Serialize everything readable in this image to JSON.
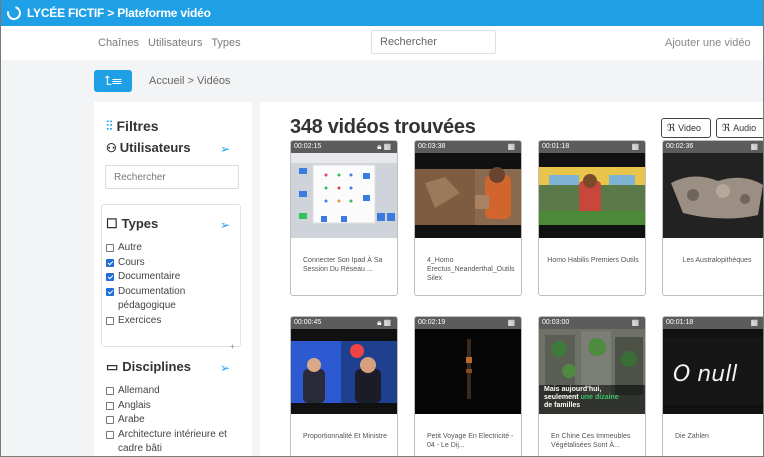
{
  "header": {
    "title": "LYCÉE FICTIF > Plateforme vidéo"
  },
  "nav": {
    "links": [
      "Chaînes",
      "Utilisateurs",
      "Types"
    ],
    "search_placeholder": "Rechercher",
    "add_video": "Ajouter une vidéo"
  },
  "breadcrumb": {
    "text": "Accueil > Vidéos",
    "menu_icon": "⮤☰"
  },
  "sidebar": {
    "filters_title": "Filtres",
    "users_title": "Utilisateurs",
    "search_placeholder": "Rechercher",
    "types": {
      "title": "Types",
      "items": [
        {
          "label": "Autre",
          "checked": false
        },
        {
          "label": "Cours",
          "checked": true
        },
        {
          "label": "Documentaire",
          "checked": true
        },
        {
          "label": "Documentation pédagogique",
          "checked": true
        },
        {
          "label": "Exercices",
          "checked": false
        }
      ]
    },
    "disciplines": {
      "title": "Disciplines",
      "items": [
        {
          "label": "Allemand",
          "checked": false
        },
        {
          "label": "Anglais",
          "checked": false
        },
        {
          "label": "Arabe",
          "checked": false
        },
        {
          "label": "Architecture intérieure et cadre bâti",
          "checked": false
        }
      ]
    }
  },
  "main": {
    "count_title": "348 vidéos trouvées",
    "feed_buttons": [
      "Video",
      "Audio"
    ],
    "videos": [
      {
        "duration": "00:02:15",
        "title": "Connecter Son Ipad À Sa Session Du Réseau ...",
        "locked": true,
        "thumb_icon": "ipad-settings-thumbnail"
      },
      {
        "duration": "00:03:38",
        "title": "4_Homo Erectus_Neanderthal_Outils Silex",
        "locked": false,
        "thumb_icon": "cave-man-thumbnail"
      },
      {
        "duration": "00:01:18",
        "title": "Homo Habilis Premiers Outils",
        "locked": false,
        "thumb_icon": "homo-habilis-thumbnail"
      },
      {
        "duration": "00:02:36",
        "title": "Les Australopithèques",
        "locked": false,
        "thumb_icon": "fossil-thumbnail"
      },
      {
        "duration": "00:00:45",
        "title": "Proportionnalité Et Ministre",
        "locked": true,
        "thumb_icon": "tv-studio-thumbnail"
      },
      {
        "duration": "00:02:19",
        "title": "Petit Voyage En Electricité - 04 - Le Dij...",
        "locked": false,
        "thumb_icon": "dark-electricity-thumbnail"
      },
      {
        "duration": "00:03:00",
        "title": "En Chine Ces Immeubles Végétalisées Sont À...",
        "locked": false,
        "overlay_line1": "Mais aujourd'hui,",
        "overlay_line2a": "seulement ",
        "overlay_line2b": "une dizaine",
        "overlay_line3": "de familles",
        "thumb_icon": "green-buildings-thumbnail"
      },
      {
        "duration": "00:01:18",
        "title": "Die Zahlen",
        "locked": false,
        "big_text": "O null",
        "thumb_icon": "die-zahlen-thumbnail"
      }
    ]
  },
  "colors": {
    "accent": "#1fa0e6",
    "checkbox": "#1f6fd6",
    "overlay_green": "#3ec36b"
  }
}
